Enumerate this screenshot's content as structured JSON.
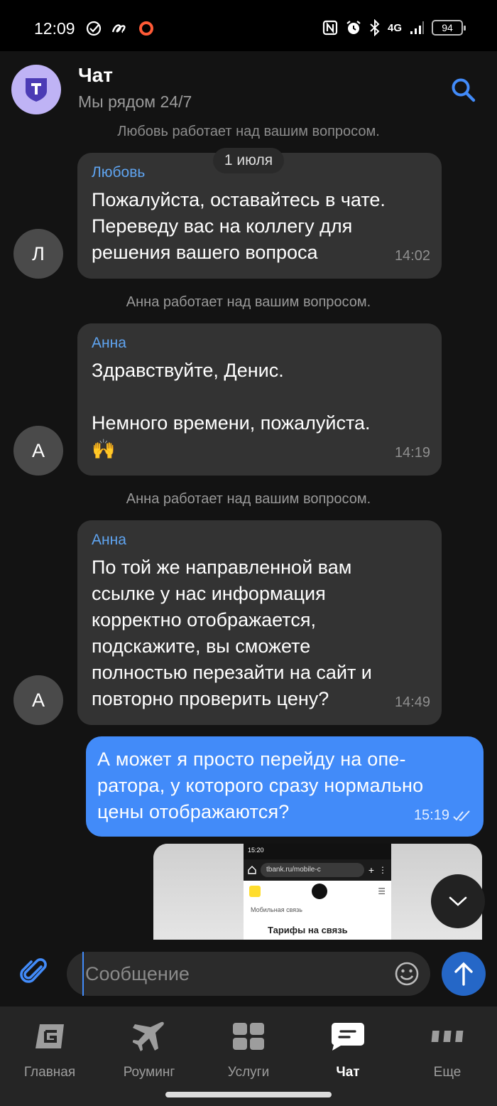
{
  "status_bar": {
    "time": "12:09",
    "network": "4G",
    "battery": "94"
  },
  "header": {
    "title": "Чат",
    "subtitle": "Мы рядом 24/7",
    "avatar_letter": "T",
    "avatar_color": "#bfb3f5",
    "search_icon": "search-icon"
  },
  "chat": {
    "system_top": "Любовь работает над вашим вопросом.",
    "date_label": "1 июля",
    "messages": [
      {
        "author": "Любовь",
        "avatar": "Л",
        "text": "Пожалуйста, оставайтесь в чате. Переведу вас на коллегу для решения вашего вопроса",
        "time": "14:02"
      },
      {
        "system": "Анна работает над вашим вопросом."
      },
      {
        "author": "Анна",
        "avatar": "А",
        "text": "Здравствуйте, Денис.\n\nНемного времени, пожалуйста.",
        "emoji": "🙌",
        "time": "14:19"
      },
      {
        "system": "Анна работает над вашим вопросом."
      },
      {
        "author": "Анна",
        "avatar": "А",
        "text": "По той же направленной вам ссылке у нас информация корректно отображается, подскажите, вы сможете полностью перезайти на сайт и повторно проверить цену?",
        "time": "14:49"
      }
    ],
    "outgoing": {
      "text": "А может я просто перейду на опе-ратора, у которого сразу нормально цены отображаются?",
      "time": "15:19",
      "status_icon": "double-check-icon"
    },
    "image_preview": {
      "time": "15:20",
      "url": "tbank.ru/mobile-c",
      "breadcrumb": "Мобильная связь",
      "heading": "Тарифы на связь"
    }
  },
  "composer": {
    "placeholder": "Сообщение",
    "value": ""
  },
  "colors": {
    "accent": "#428bf9",
    "author": "#5fa4f0",
    "bubble_in": "#333333",
    "background": "#131313"
  },
  "tabs": [
    {
      "label": "Главная",
      "icon": "home-icon",
      "active": false
    },
    {
      "label": "Роуминг",
      "icon": "airplane-icon",
      "active": false
    },
    {
      "label": "Услуги",
      "icon": "grid-icon",
      "active": false
    },
    {
      "label": "Чат",
      "icon": "chat-icon",
      "active": true
    },
    {
      "label": "Еще",
      "icon": "more-icon",
      "active": false
    }
  ]
}
